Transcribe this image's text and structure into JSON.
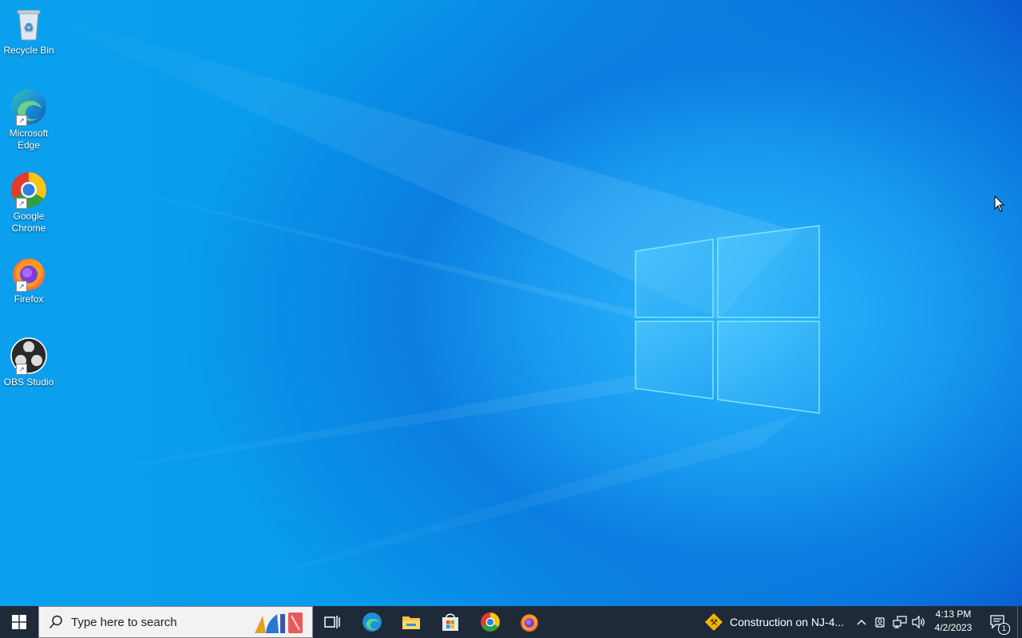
{
  "desktop": {
    "icons": [
      {
        "label": "Recycle Bin",
        "icon": "recycle-bin-icon"
      },
      {
        "label": "Microsoft Edge",
        "icon": "edge-icon"
      },
      {
        "label": "Google Chrome",
        "icon": "chrome-icon"
      },
      {
        "label": "Firefox",
        "icon": "firefox-icon"
      },
      {
        "label": "OBS Studio",
        "icon": "obs-icon"
      }
    ]
  },
  "taskbar": {
    "search_placeholder": "Type here to search",
    "pinned": [
      "task-view-icon",
      "edge-icon",
      "file-explorer-icon",
      "store-icon",
      "chrome-icon",
      "firefox-icon"
    ],
    "news_text": "Construction on NJ-4...",
    "clock_time": "4:13 PM",
    "clock_date": "4/2/2023",
    "notification_count": "1"
  },
  "colors": {
    "taskbar_bg": "#1f2a38",
    "wallpaper_accent": "#1a9cf0"
  }
}
